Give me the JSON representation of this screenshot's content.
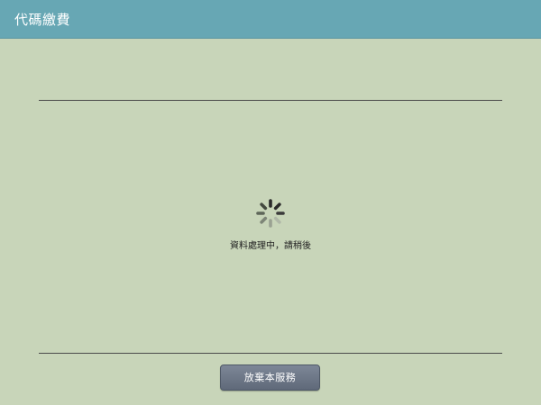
{
  "header": {
    "title": "代碼繳費"
  },
  "main": {
    "loading_text": "資料處理中，請稍後",
    "spinner_icon": "loading-spinner-icon"
  },
  "footer": {
    "abandon_button_label": "放棄本服務"
  },
  "colors": {
    "header_bg": "#67a7b4",
    "page_bg": "#c8d5b9",
    "button_bg": "#6b7585"
  }
}
